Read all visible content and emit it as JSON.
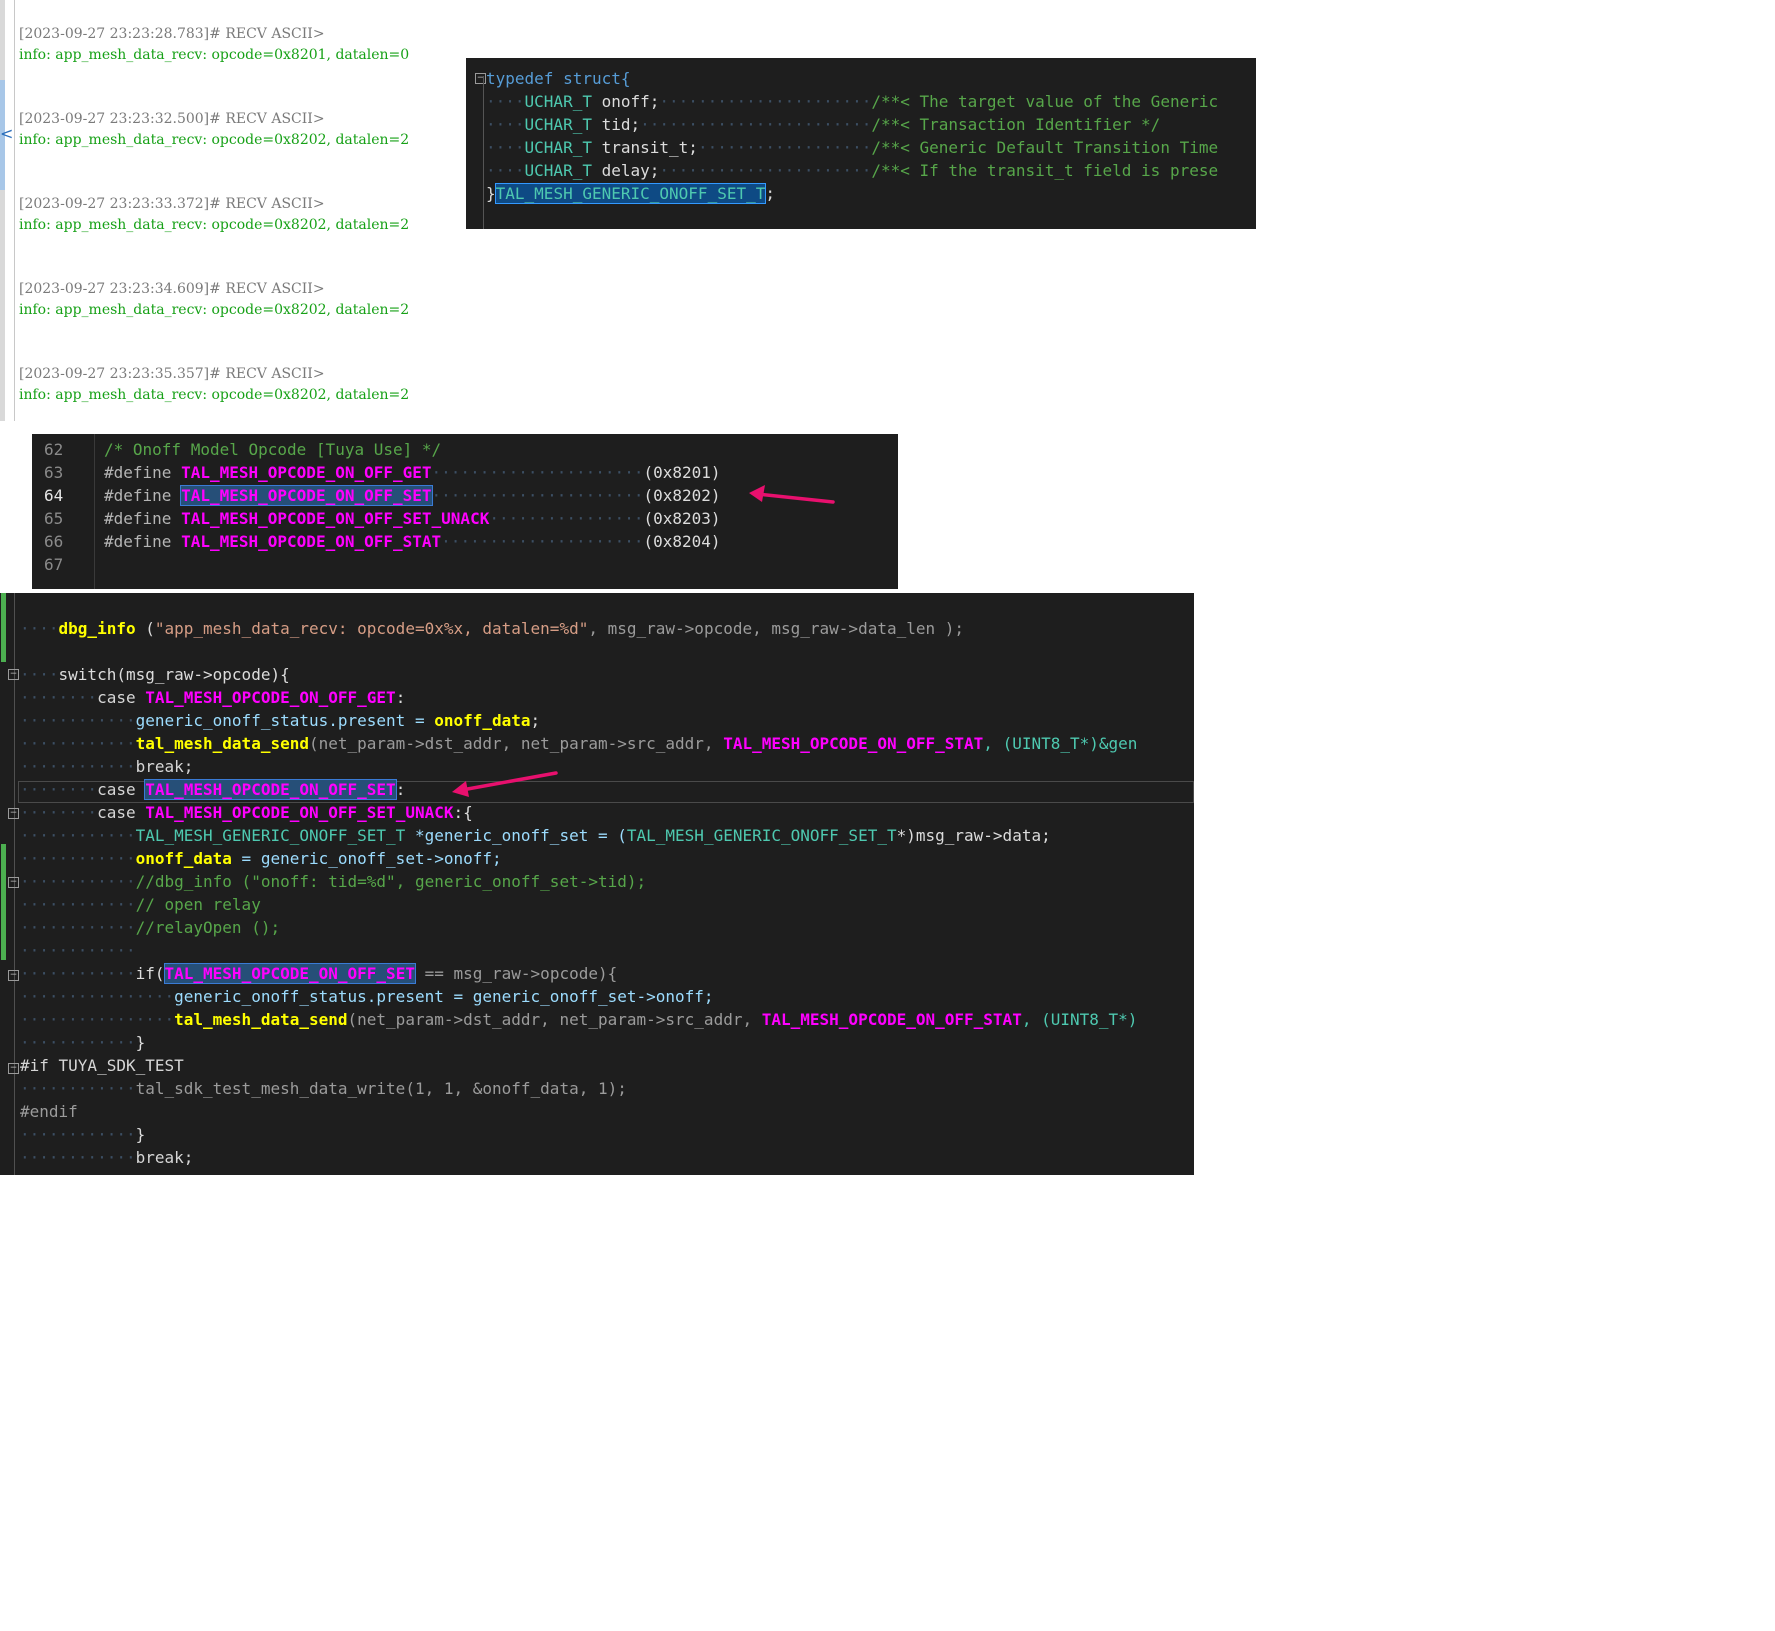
{
  "terminal": {
    "entries": [
      {
        "header": "[2023-09-27 23:23:28.783]# RECV ASCII>",
        "info": "info: app_mesh_data_recv: opcode=0x8201, datalen=0"
      },
      {
        "header": "[2023-09-27 23:23:32.500]# RECV ASCII>",
        "info": "info: app_mesh_data_recv: opcode=0x8202, datalen=2"
      },
      {
        "header": "[2023-09-27 23:23:33.372]# RECV ASCII>",
        "info": "info: app_mesh_data_recv: opcode=0x8202, datalen=2"
      },
      {
        "header": "[2023-09-27 23:23:34.609]# RECV ASCII>",
        "info": "info: app_mesh_data_recv: opcode=0x8202, datalen=2"
      },
      {
        "header": "[2023-09-27 23:23:35.357]# RECV ASCII>",
        "info": "info: app_mesh_data_recv: opcode=0x8202, datalen=2"
      }
    ],
    "collapse_glyph": "<"
  },
  "struct_panel": {
    "typedef_kw": "typedef",
    "struct_kw": "struct{",
    "fields": [
      {
        "type": "UCHAR_T",
        "name": "onoff;",
        "comment": "/**< The target value of the Generic"
      },
      {
        "type": "UCHAR_T",
        "name": "tid;",
        "comment": "/**< Transaction Identifier */"
      },
      {
        "type": "UCHAR_T",
        "name": "transit_t;",
        "comment": "/**< Generic Default Transition Time"
      },
      {
        "type": "UCHAR_T",
        "name": "delay;",
        "comment": "/**< If the transit_t field is prese"
      }
    ],
    "close_brace": "}",
    "typename": "TAL_MESH_GENERIC_ONOFF_SET_T",
    "semicolon": ";"
  },
  "define_panel": {
    "comment_line": {
      "num": "62",
      "text": "/* Onoff Model Opcode [Tuya Use] */"
    },
    "defines": [
      {
        "num": "63",
        "directive": "#define",
        "name": "TAL_MESH_OPCODE_ON_OFF_GET",
        "value": "(0x8201)"
      },
      {
        "num": "64",
        "directive": "#define",
        "name": "TAL_MESH_OPCODE_ON_OFF_SET",
        "value": "(0x8202)"
      },
      {
        "num": "65",
        "directive": "#define",
        "name": "TAL_MESH_OPCODE_ON_OFF_SET_UNACK",
        "value": "(0x8203)"
      },
      {
        "num": "66",
        "directive": "#define",
        "name": "TAL_MESH_OPCODE_ON_OFF_STAT",
        "value": "(0x8204)"
      }
    ],
    "empty_line_num": "67"
  },
  "switch_panel": {
    "l_dbg_fn": "dbg_info",
    "l_dbg_open": " (",
    "l_dbg_str": "\"app_mesh_data_recv: opcode=0x%x, datalen=%d\"",
    "l_dbg_args": ", msg_raw->opcode, msg_raw->data_len );",
    "l_switch": "switch(msg_raw->opcode){",
    "case_kw": "case",
    "case_get": "TAL_MESH_OPCODE_ON_OFF_GET",
    "colon": ":",
    "l_present_lhs": "generic_onoff_status.present = ",
    "onoff_data": "onoff_data",
    "semi": ";",
    "send_fn": "tal_mesh_data_send",
    "send_args1": "(net_param->dst_addr, net_param->src_addr, ",
    "stat_macro": "TAL_MESH_OPCODE_ON_OFF_STAT",
    "send_args2a": ", (UINT8_T*)&gen",
    "send_args2b": ", (UINT8_T*)",
    "break_kw": "break;",
    "case_set": "TAL_MESH_OPCODE_ON_OFF_SET",
    "case_unack": "TAL_MESH_OPCODE_ON_OFF_SET_UNACK",
    "colon_brace": ":{",
    "set_type": "TAL_MESH_GENERIC_ONOFF_SET_T",
    "set_decl": " *generic_onoff_set = (",
    "set_cast_end": "*)msg_raw->data;",
    "onoff_assign": " = generic_onoff_set->onoff;",
    "cmt1": "//dbg_info (\"onoff: tid=%d\", generic_onoff_set->tid);",
    "cmt2": "// open relay",
    "cmt3": "//relayOpen ();",
    "if_kw": "if(",
    "if_rest": " == msg_raw->opcode){",
    "present_from_set": "generic_onoff_status.present = generic_onoff_set->onoff;",
    "close_brace": "}",
    "pp_if": "#if TUYA_SDK_TEST",
    "sdk_call": "tal_sdk_test_mesh_data_write(1, 1, &onoff_data, 1);",
    "pp_endif": "#endif"
  },
  "colors": {
    "editor_bg": "#1e1e1e",
    "macro": "#ff00ff",
    "function": "#ffff00",
    "comment": "#57a64a",
    "selection": "#264f78",
    "arrow": "#e8106e",
    "log_info": "#17a117",
    "log_header": "#7a7a7a"
  }
}
